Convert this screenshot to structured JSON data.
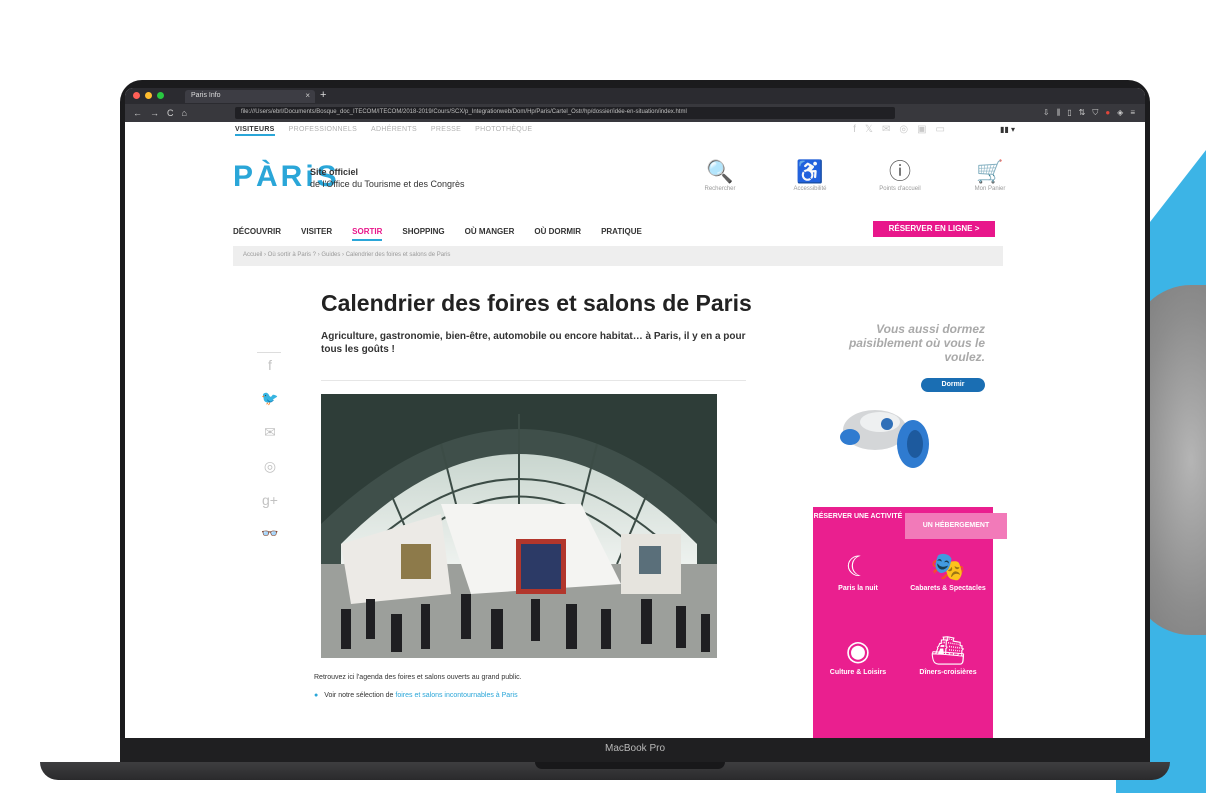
{
  "browser": {
    "tab_title": "Paris Info",
    "new_tab": "+",
    "url": "file:///Users/ebrl/Documents/Bosque_doc_ITECOM/ITECOM/2018-2019/Cours/SCX/p_Integrationweb/Dom/Hp/Paris/Cartel_Ostr/hp/dossier/idée-en-situation/index.html",
    "nav": {
      "back": "←",
      "forward": "→",
      "reload": "C",
      "home": "⌂"
    },
    "toolbar_icons": [
      "download-icon",
      "library-icon",
      "sidebar-icon",
      "sync-icon",
      "shield-icon",
      "adblock-icon",
      "extensions-icon",
      "menu-icon"
    ]
  },
  "site": {
    "top_links": [
      "VISITEURS",
      "PROFESSIONNELS",
      "ADHÉRENTS",
      "PRESSE",
      "PHOTOTHÈQUE"
    ],
    "social_icons": [
      "f",
      "𝕏",
      "✉",
      "◎",
      "▣",
      "▭"
    ],
    "language": "▮▮ ▾",
    "logo": "PÀRiS",
    "logo_line1": "Site officiel",
    "logo_line2": "de l'Office du Tourisme et des Congrès",
    "header_icons": [
      {
        "name": "search",
        "symbol": "🔍",
        "label": "Rechercher"
      },
      {
        "name": "accessibility",
        "symbol": "♿",
        "label": "Accessibilité"
      },
      {
        "name": "info",
        "symbol": "ⓘ",
        "label": "Points d'accueil"
      },
      {
        "name": "cart",
        "symbol": "🛒",
        "label": "Mon Panier"
      }
    ],
    "nav": [
      "DÉCOUVRIR",
      "VISITER",
      "SORTIR",
      "SHOPPING",
      "OÙ MANGER",
      "OÙ DORMIR",
      "PRATIQUE"
    ],
    "reserve_button": "RÉSERVER EN LIGNE  >",
    "breadcrumb": "Accueil › Où sortir à Paris ? › Guides › Calendrier des foires et salons de Paris",
    "share_icons": [
      "f",
      "🐦",
      "✉",
      "◎",
      "g+",
      "👓"
    ],
    "title": "Calendrier des foires et salons de Paris",
    "subtitle": "Agriculture, gastronomie, bien-être, automobile ou encore habitat… à Paris, il y en a pour tous les goûts !",
    "caption": "Retrouvez ici l'agenda des foires et salons ouverts au grand public.",
    "voir_prefix": "Voir notre sélection de",
    "voir_link": "foires et salons incontournables à Paris",
    "ad_text": "Vous aussi dormez paisiblement où vous le voulez.",
    "ad_button": "Dormir",
    "panel": {
      "tab1": "RÉSERVER UNE ACTIVITÉ",
      "tab2": "UN HÉBERGEMENT",
      "items": [
        {
          "icon": "☾",
          "label": "Paris la nuit"
        },
        {
          "icon": "🎭",
          "label": "Cabarets & Spectacles"
        },
        {
          "icon": "◉",
          "label": "Culture & Loisirs"
        },
        {
          "icon": "⛴",
          "label": "Dîners-croisières"
        }
      ]
    }
  },
  "laptop": {
    "model": "MacBook Pro"
  },
  "colors": {
    "accent_blue": "#2aa6d8",
    "accent_pink": "#e8178b",
    "panel_pink": "#ea1f8f",
    "ad_blue": "#1a6eb3"
  }
}
